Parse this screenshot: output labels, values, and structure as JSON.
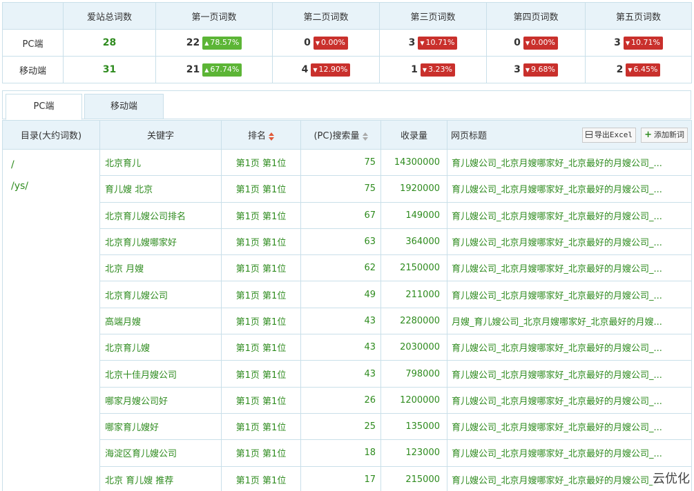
{
  "summary": {
    "headers": [
      "",
      "爱站总词数",
      "第一页词数",
      "第二页词数",
      "第三页词数",
      "第四页词数",
      "第五页词数"
    ],
    "rows": [
      {
        "label": "PC端",
        "total": "28",
        "pages": [
          {
            "count": "22",
            "pct": "78.57%",
            "dir": "up"
          },
          {
            "count": "0",
            "pct": "0.00%",
            "dir": "down"
          },
          {
            "count": "3",
            "pct": "10.71%",
            "dir": "down"
          },
          {
            "count": "0",
            "pct": "0.00%",
            "dir": "down"
          },
          {
            "count": "3",
            "pct": "10.71%",
            "dir": "down"
          }
        ]
      },
      {
        "label": "移动端",
        "total": "31",
        "pages": [
          {
            "count": "21",
            "pct": "67.74%",
            "dir": "up"
          },
          {
            "count": "4",
            "pct": "12.90%",
            "dir": "down"
          },
          {
            "count": "1",
            "pct": "3.23%",
            "dir": "down"
          },
          {
            "count": "3",
            "pct": "9.68%",
            "dir": "down"
          },
          {
            "count": "2",
            "pct": "6.45%",
            "dir": "down"
          }
        ]
      }
    ]
  },
  "tabs": {
    "pc": "PC端",
    "mobile": "移动端"
  },
  "table": {
    "headers": {
      "dir": "目录(大约词数)",
      "keyword": "关键字",
      "rank": "排名",
      "volume": "(PC)搜索量",
      "indexed": "收录量",
      "title": "网页标题"
    },
    "export_label": "导出Excel",
    "add_label": "添加新词",
    "dirs": [
      "/",
      "/ys/"
    ],
    "rows": [
      {
        "keyword": "北京育儿",
        "rank": "第1页 第1位",
        "volume": "75",
        "indexed": "14300000",
        "title": "育儿嫂公司_北京月嫂哪家好_北京最好的月嫂公司_..."
      },
      {
        "keyword": "育儿嫂 北京",
        "rank": "第1页 第1位",
        "volume": "75",
        "indexed": "1920000",
        "title": "育儿嫂公司_北京月嫂哪家好_北京最好的月嫂公司_..."
      },
      {
        "keyword": "北京育儿嫂公司排名",
        "rank": "第1页 第1位",
        "volume": "67",
        "indexed": "149000",
        "title": "育儿嫂公司_北京月嫂哪家好_北京最好的月嫂公司_..."
      },
      {
        "keyword": "北京育儿嫂哪家好",
        "rank": "第1页 第1位",
        "volume": "63",
        "indexed": "364000",
        "title": "育儿嫂公司_北京月嫂哪家好_北京最好的月嫂公司_..."
      },
      {
        "keyword": "北京 月嫂",
        "rank": "第1页 第1位",
        "volume": "62",
        "indexed": "2150000",
        "title": "育儿嫂公司_北京月嫂哪家好_北京最好的月嫂公司_..."
      },
      {
        "keyword": "北京育儿嫂公司",
        "rank": "第1页 第1位",
        "volume": "49",
        "indexed": "211000",
        "title": "育儿嫂公司_北京月嫂哪家好_北京最好的月嫂公司_..."
      },
      {
        "keyword": "高端月嫂",
        "rank": "第1页 第1位",
        "volume": "43",
        "indexed": "2280000",
        "title": "月嫂_育儿嫂公司_北京月嫂哪家好_北京最好的月嫂..."
      },
      {
        "keyword": "北京育儿嫂",
        "rank": "第1页 第1位",
        "volume": "43",
        "indexed": "2030000",
        "title": "育儿嫂公司_北京月嫂哪家好_北京最好的月嫂公司_..."
      },
      {
        "keyword": "北京十佳月嫂公司",
        "rank": "第1页 第1位",
        "volume": "43",
        "indexed": "798000",
        "title": "育儿嫂公司_北京月嫂哪家好_北京最好的月嫂公司_..."
      },
      {
        "keyword": "哪家月嫂公司好",
        "rank": "第1页 第1位",
        "volume": "26",
        "indexed": "1200000",
        "title": "育儿嫂公司_北京月嫂哪家好_北京最好的月嫂公司_..."
      },
      {
        "keyword": "哪家育儿嫂好",
        "rank": "第1页 第1位",
        "volume": "25",
        "indexed": "135000",
        "title": "育儿嫂公司_北京月嫂哪家好_北京最好的月嫂公司_..."
      },
      {
        "keyword": "海淀区育儿嫂公司",
        "rank": "第1页 第1位",
        "volume": "18",
        "indexed": "123000",
        "title": "育儿嫂公司_北京月嫂哪家好_北京最好的月嫂公司_..."
      },
      {
        "keyword": "北京 育儿嫂 推荐",
        "rank": "第1页 第1位",
        "volume": "17",
        "indexed": "215000",
        "title": "育儿嫂公司_北京月嫂哪家好_北京最好的月嫂公司_..."
      }
    ]
  },
  "watermark": "云优化",
  "colors": {
    "accent_green": "#2e8b1e",
    "up_badge": "#5cb536",
    "down_badge": "#c9302c",
    "header_bg": "#e8f3f9",
    "border": "#c9dfe9"
  }
}
